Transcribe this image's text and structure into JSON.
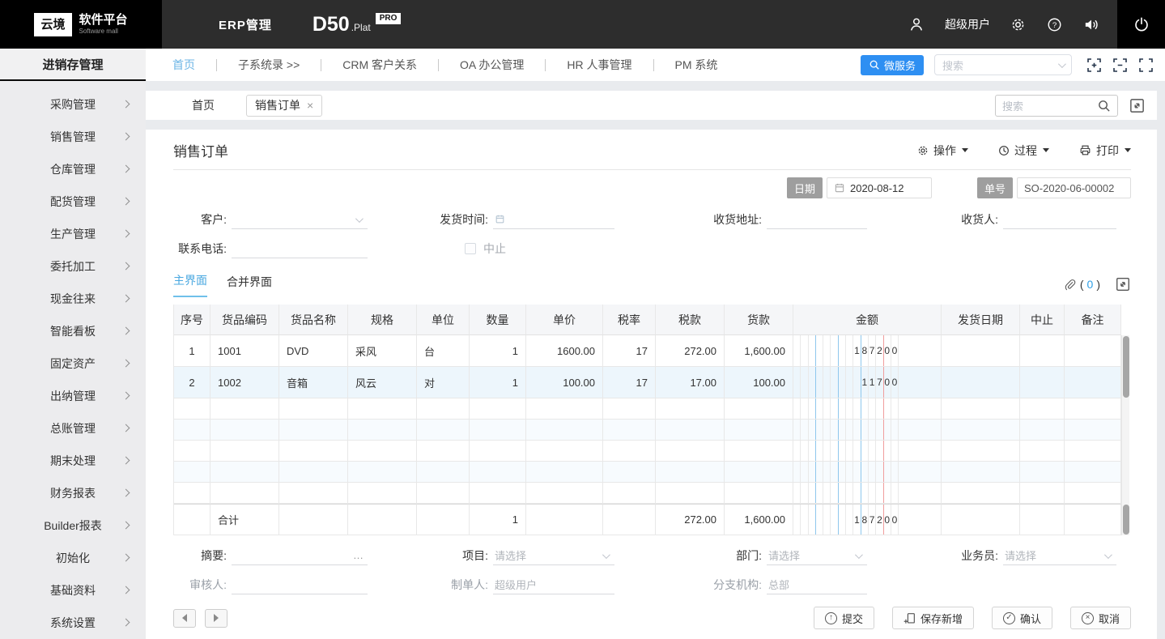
{
  "colors": {
    "accent_blue": "#2e8ff2",
    "nav_active_blue": "#6cb5e5",
    "tab_active_blue": "#4aa8e0",
    "topbar_dark": "#2d2d2d",
    "row_alt_blue": "#edf6fc"
  },
  "topbar": {
    "logo_mark": "云境",
    "logo_name": "软件平台",
    "logo_sub": "Software mall",
    "app_name": "ERP管理",
    "product": "D50",
    "product_suffix": ".Plat",
    "product_badge": "PRO",
    "username": "超级用户"
  },
  "subbar": {
    "module_title": "进销存管理",
    "nav_items": [
      "首页",
      "子系统录 >>",
      "CRM 客户关系",
      "OA 办公管理",
      "HR 人事管理",
      "PM 系统"
    ],
    "active_nav_index": 0,
    "microservice_label": "微服务",
    "search_placeholder": "搜索"
  },
  "sidebar": {
    "items": [
      "采购管理",
      "销售管理",
      "仓库管理",
      "配货管理",
      "生产管理",
      "委托加工",
      "现金往来",
      "智能看板",
      "固定资产",
      "出纳管理",
      "总账管理",
      "期末处理",
      "财务报表",
      "Builder报表",
      "初始化",
      "基础资料",
      "系统设置"
    ]
  },
  "tabbar": {
    "home_label": "首页",
    "tab_label": "销售订单",
    "tab_close": "×",
    "search_placeholder": "搜索"
  },
  "header": {
    "title": "销售订单",
    "operate_label": "操作",
    "process_label": "过程",
    "print_label": "打印",
    "date_label": "日期",
    "date_value": "2020-08-12",
    "no_label": "单号",
    "no_value": "SO-2020-06-00002"
  },
  "form": {
    "customer_label": "客户:",
    "ship_time_label": "发货时间:",
    "address_label": "收货地址:",
    "receiver_label": "收货人:",
    "phone_label": "联系电话:",
    "abort_label": "中止"
  },
  "detail": {
    "tab_main": "主界面",
    "tab_merge": "合并界面",
    "attach_open": "(",
    "attach_count": "0",
    "attach_close": ")"
  },
  "table": {
    "headers": [
      "序号",
      "货品编码",
      "货品名称",
      "规格",
      "单位",
      "数量",
      "单价",
      "税率",
      "税款",
      "货款",
      "金额",
      "发货日期",
      "中止",
      "备注"
    ],
    "rows": [
      {
        "cells": [
          "1",
          "1001",
          "DVD",
          "采风",
          "台",
          "1",
          "1600.00",
          "17",
          "272.00",
          "1,600.00"
        ],
        "amount": [
          "",
          "",
          "",
          "",
          "",
          "",
          "",
          "",
          "1",
          "8",
          "7",
          "2",
          "0",
          "0"
        ],
        "tail": [
          "",
          "",
          ""
        ]
      },
      {
        "cells": [
          "2",
          "1002",
          "音箱",
          "风云",
          "对",
          "1",
          "100.00",
          "17",
          "17.00",
          "100.00"
        ],
        "amount": [
          "",
          "",
          "",
          "",
          "",
          "",
          "",
          "",
          "",
          "1",
          "1",
          "7",
          "0",
          "0"
        ],
        "tail": [
          "",
          "",
          ""
        ]
      }
    ],
    "empty_row_count": 5,
    "total_row": {
      "cells": [
        "",
        "合计",
        "",
        "",
        "",
        "1",
        "",
        "",
        "272.00",
        "1,600.00"
      ],
      "amount": [
        "",
        "",
        "",
        "",
        "",
        "",
        "",
        "",
        "1",
        "8",
        "7",
        "2",
        "0",
        "0"
      ],
      "tail": [
        "",
        "",
        ""
      ]
    }
  },
  "footer_form": {
    "summary_label": "摘要:",
    "summary_more": "…",
    "project_label": "项目:",
    "project_placeholder": "请选择",
    "dept_label": "部门:",
    "dept_placeholder": "请选择",
    "salesman_label": "业务员:",
    "salesman_placeholder": "请选择",
    "auditor_label": "审核人:",
    "auditor_value": "",
    "maker_label": "制单人:",
    "maker_value": "超级用户",
    "branch_label": "分支机构:",
    "branch_value": "总部"
  },
  "actions": {
    "submit": "提交",
    "save_new": "保存新增",
    "confirm": "确认",
    "cancel": "取消"
  }
}
